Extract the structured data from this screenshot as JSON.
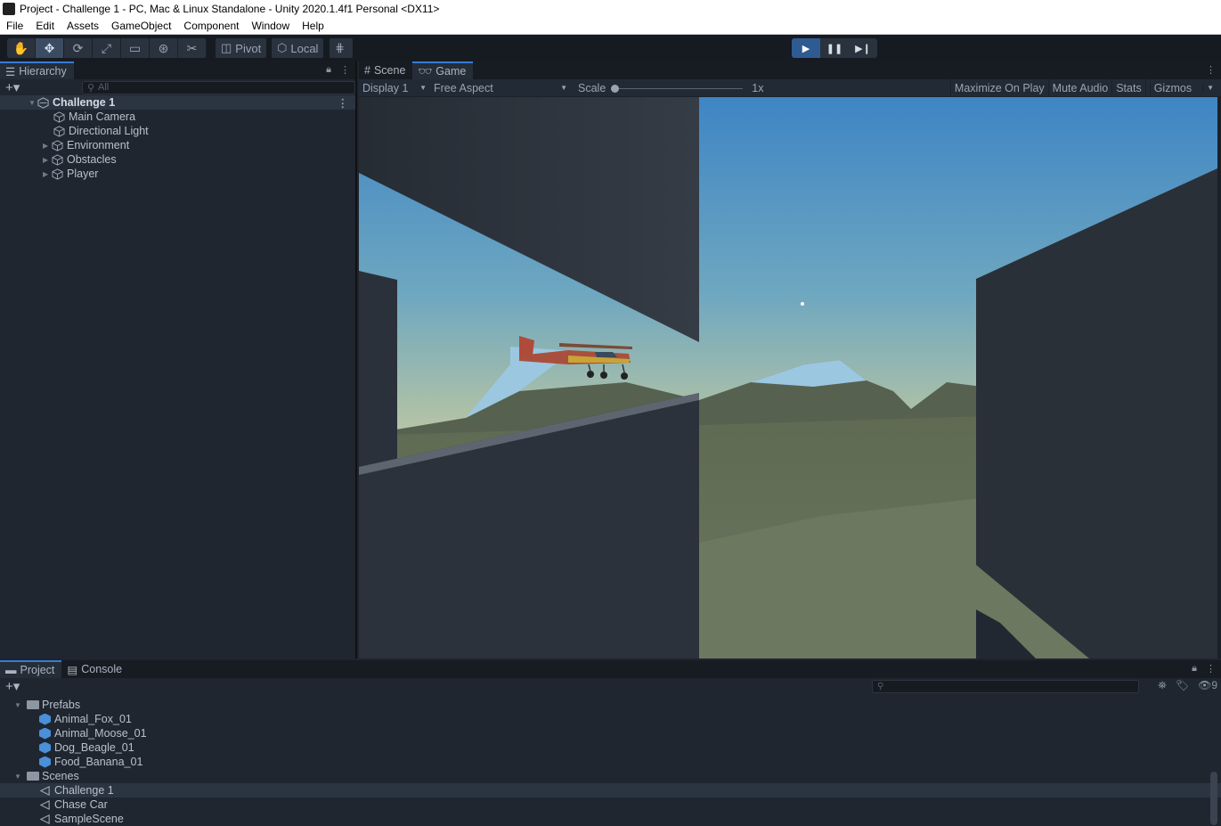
{
  "window": {
    "title": "Project - Challenge 1 - PC, Mac & Linux Standalone - Unity 2020.1.4f1 Personal <DX11>"
  },
  "menu": [
    "File",
    "Edit",
    "Assets",
    "GameObject",
    "Component",
    "Window",
    "Help"
  ],
  "toolbar": {
    "pivot_label": "Pivot",
    "local_label": "Local"
  },
  "hierarchy": {
    "tab_label": "Hierarchy",
    "search_placeholder": "All",
    "scene": "Challenge 1",
    "items": [
      {
        "label": "Main Camera",
        "expandable": false
      },
      {
        "label": "Directional Light",
        "expandable": false
      },
      {
        "label": "Environment",
        "expandable": true
      },
      {
        "label": "Obstacles",
        "expandable": true
      },
      {
        "label": "Player",
        "expandable": true
      }
    ]
  },
  "game_view": {
    "tabs": [
      "Scene",
      "Game"
    ],
    "active_tab": "Game",
    "display": "Display 1",
    "aspect": "Free Aspect",
    "scale_label": "Scale",
    "scale_value": "1x",
    "buttons": [
      "Maximize On Play",
      "Mute Audio",
      "Stats",
      "Gizmos"
    ]
  },
  "project": {
    "tabs": [
      "Project",
      "Console"
    ],
    "active_tab": "Project",
    "hidden_count": "9",
    "folders": [
      {
        "name": "Prefabs",
        "items": [
          "Animal_Fox_01",
          "Animal_Moose_01",
          "Dog_Beagle_01",
          "Food_Banana_01"
        ]
      },
      {
        "name": "Scenes",
        "items": [
          "Challenge 1",
          "Chase Car",
          "SampleScene"
        ]
      }
    ],
    "selected_item": "Challenge 1"
  },
  "colors": {
    "accent": "#3a7bd5",
    "play_active": "#2f5b93",
    "prefab_blue": "#4a8fd8"
  }
}
